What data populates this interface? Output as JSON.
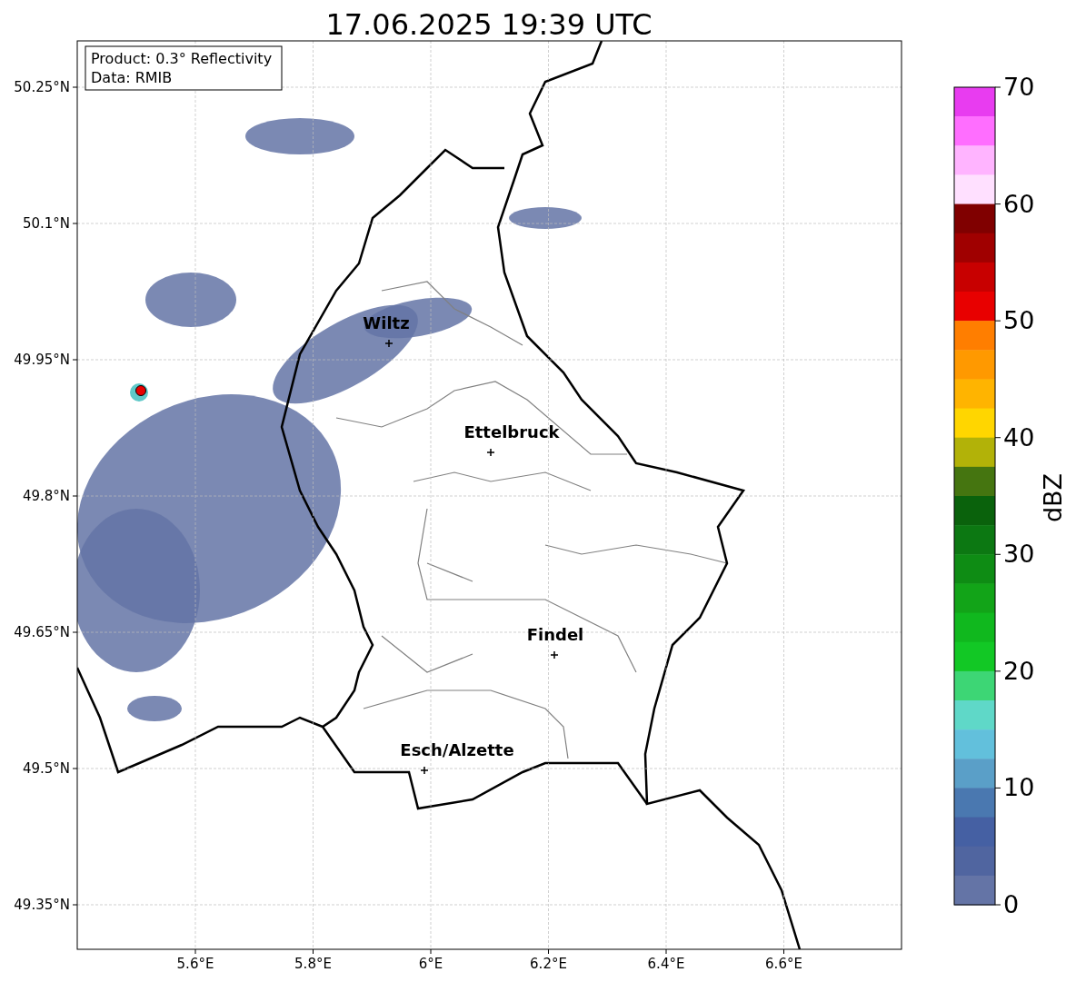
{
  "title": "17.06.2025 19:39 UTC",
  "info_box": {
    "lines": [
      "Product: 0.3° Reflectivity",
      "Data: RMIB"
    ]
  },
  "map": {
    "cities": [
      {
        "name": "Wiltz"
      },
      {
        "name": "Ettelbruck"
      },
      {
        "name": "Findel"
      },
      {
        "name": "Esch/Alzette"
      }
    ]
  },
  "x_ticks": [
    "5.6°E",
    "5.8°E",
    "6°E",
    "6.2°E",
    "6.4°E",
    "6.6°E"
  ],
  "y_ticks": [
    "50.25°N",
    "50.1°N",
    "49.95°N",
    "49.8°N",
    "49.65°N",
    "49.5°N",
    "49.35°N"
  ],
  "colorbar": {
    "label": "dBZ",
    "ticks": [
      "70",
      "60",
      "50",
      "40",
      "30",
      "20",
      "10",
      "0"
    ],
    "bins": [
      {
        "color": "#e83cf0"
      },
      {
        "color": "#ff6eff"
      },
      {
        "color": "#ffb4ff"
      },
      {
        "color": "#ffe0ff"
      },
      {
        "color": "#800000"
      },
      {
        "color": "#a00000"
      },
      {
        "color": "#c80000"
      },
      {
        "color": "#e80000"
      },
      {
        "color": "#ff7e00"
      },
      {
        "color": "#ff9900"
      },
      {
        "color": "#ffb400"
      },
      {
        "color": "#ffd600"
      },
      {
        "color": "#b2b208"
      },
      {
        "color": "#457510"
      },
      {
        "color": "#0a620c"
      },
      {
        "color": "#0c7812"
      },
      {
        "color": "#0e8c14"
      },
      {
        "color": "#12a418"
      },
      {
        "color": "#10b81e"
      },
      {
        "color": "#12c825"
      },
      {
        "color": "#3dd675"
      },
      {
        "color": "#5fd8c8"
      },
      {
        "color": "#62c0dc"
      },
      {
        "color": "#5a9fc8"
      },
      {
        "color": "#4a78b0"
      },
      {
        "color": "#4560a3"
      },
      {
        "color": "#5065a0"
      },
      {
        "color": "#6474a6"
      }
    ]
  }
}
